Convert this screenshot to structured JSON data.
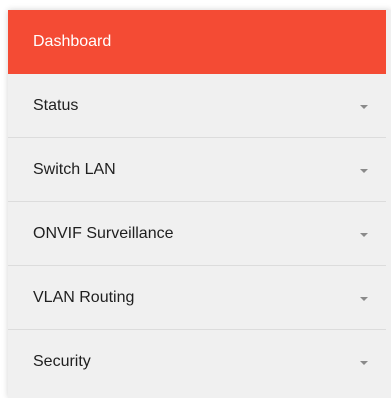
{
  "sidebar": {
    "items": [
      {
        "label": "Dashboard",
        "active": true,
        "has_submenu": false
      },
      {
        "label": "Status",
        "active": false,
        "has_submenu": true
      },
      {
        "label": "Switch LAN",
        "active": false,
        "has_submenu": true
      },
      {
        "label": "ONVIF Surveillance",
        "active": false,
        "has_submenu": true
      },
      {
        "label": "VLAN Routing",
        "active": false,
        "has_submenu": true
      },
      {
        "label": "Security",
        "active": false,
        "has_submenu": true
      }
    ],
    "icons": {
      "expand": "chevron-down-icon"
    },
    "colors": {
      "active_bg": "#f44b34",
      "menu_bg": "#f0f0f0",
      "text": "#1f1f1f",
      "chevron": "#8a8a8a"
    }
  }
}
